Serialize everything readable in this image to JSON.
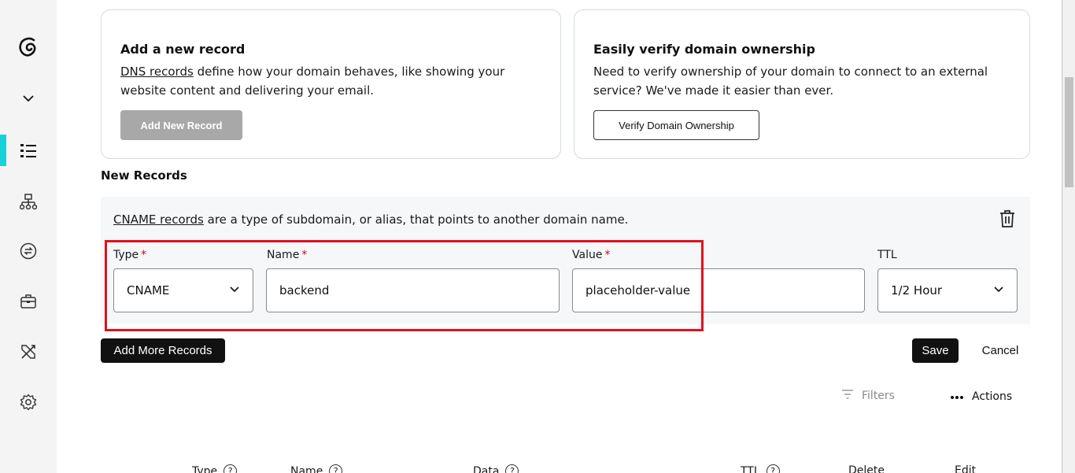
{
  "add_card": {
    "title": "Add a new record",
    "link_text": "DNS records",
    "description": " define how your domain behaves, like showing your website content and delivering your email.",
    "button_label": "Add New Record"
  },
  "verify_card": {
    "title": "Easily verify domain ownership",
    "description": "Need to verify ownership of your domain to connect to an external service? We've made it easier than ever.",
    "button_label": "Verify Domain Ownership"
  },
  "new_records": {
    "section_title": "New Records",
    "link_text": "CNAME records",
    "description": " are a type of subdomain, or alias, that points to another domain name.",
    "fields": {
      "type": {
        "label": "Type",
        "required_mark": "*",
        "value": "CNAME"
      },
      "name": {
        "label": "Name",
        "required_mark": "*",
        "value": "backend"
      },
      "value": {
        "label": "Value",
        "required_mark": "*",
        "value": "placeholder-value"
      },
      "ttl": {
        "label": "TTL",
        "value": "1/2 Hour"
      }
    },
    "add_more_label": "Add More Records",
    "save_label": "Save",
    "cancel_label": "Cancel"
  },
  "toolbar": {
    "filters_label": "Filters",
    "actions_label": "Actions"
  },
  "table": {
    "columns": [
      "Type",
      "Name",
      "Data",
      "TTL",
      "Delete",
      "Edit"
    ]
  },
  "colors": {
    "accent": "#18d2d8",
    "highlight": "#e0101e",
    "required": "#d6001c"
  }
}
